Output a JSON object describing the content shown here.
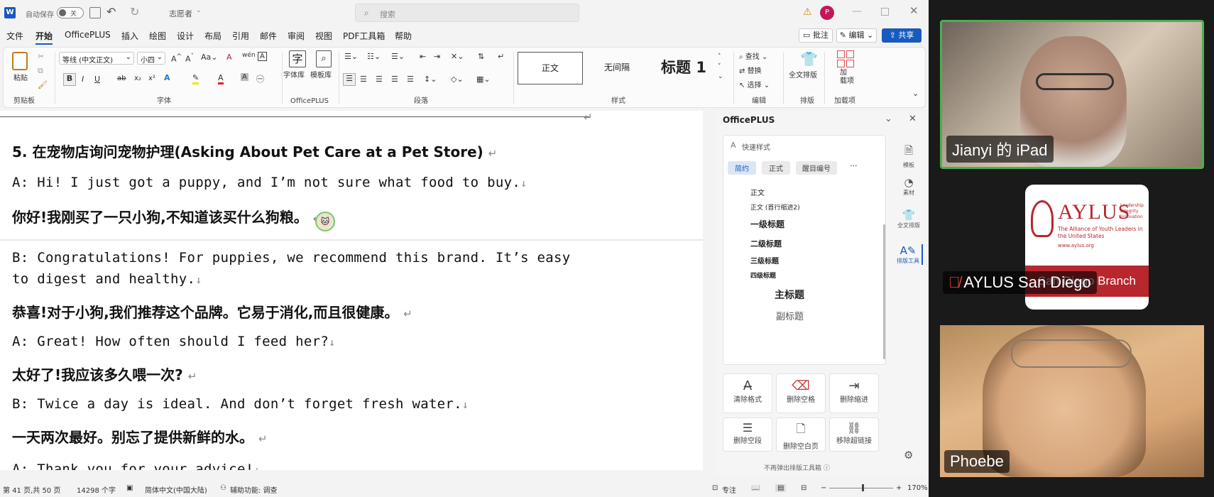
{
  "titlebar": {
    "autosave_label": "自动保存",
    "autosave_state": "关",
    "doc_title": "志愿者",
    "search_placeholder": "搜索",
    "avatar": "P"
  },
  "menu": [
    "文件",
    "开始",
    "OfficePLUS",
    "插入",
    "绘图",
    "设计",
    "布局",
    "引用",
    "邮件",
    "审阅",
    "视图",
    "PDF工具箱",
    "帮助"
  ],
  "menu_active": "开始",
  "actions": {
    "comment": "批注",
    "edit": "编辑",
    "share": "共享"
  },
  "ribbon": {
    "paste": "粘贴",
    "clipboard": "剪贴板",
    "font_name": "等线 (中文正文)",
    "font_size": "小四",
    "font_group": "字体",
    "zitiku": "字体库",
    "mobanku": "模板库",
    "officeplus_group": "OfficePLUS",
    "paragraph_group": "段落",
    "styles": [
      "正文",
      "无间隔",
      "标题 1"
    ],
    "styles_group": "样式",
    "find": "查找",
    "replace": "替换",
    "select": "选择",
    "edit_group": "编辑",
    "layout": "全文排版",
    "layout_group": "排版",
    "addin": "加\n载项",
    "addin_group": "加载项"
  },
  "doc": [
    {
      "t": "5. 在宠物店询问宠物护理(Asking About Pet Care at a Pet Store)",
      "k": "h"
    },
    {
      "t": "A: Hi! I just got a puppy, and I’m not sure what food to buy.",
      "k": "en",
      "m": "↓"
    },
    {
      "t": "你好!我刚买了一只小狗,不知道该买什么狗粮。",
      "k": "zh",
      "m": "↵"
    },
    {
      "t": "B: Congratulations! For puppies, we recommend this brand. It’s easy",
      "k": "en",
      "m": ""
    },
    {
      "t": "to digest and healthy.",
      "k": "en",
      "m": "↓"
    },
    {
      "t": "恭喜!对于小狗,我们推荐这个品牌。它易于消化,而且很健康。",
      "k": "zh",
      "m": "↵"
    },
    {
      "t": "A: Great! How often should I feed her?",
      "k": "en",
      "m": "↓"
    },
    {
      "t": "太好了!我应该多久喂一次?",
      "k": "zh",
      "m": "↵"
    },
    {
      "t": "B: Twice a day is ideal. And don’t forget fresh water.",
      "k": "en",
      "m": "↓"
    },
    {
      "t": "一天两次最好。别忘了提供新鲜的水。",
      "k": "zh",
      "m": "↵"
    },
    {
      "t": "A: Thank you for your advice!",
      "k": "en",
      "m": "↓"
    }
  ],
  "pane": {
    "title": "OfficePLUS",
    "quick": "快速样式",
    "chips": [
      "简约",
      "正式",
      "醒目编号"
    ],
    "styles": [
      "正文",
      "正文 (首行缩进2)",
      "一级标题",
      "二级标题",
      "三级标题",
      "四级标题",
      "主标题",
      "副标题"
    ],
    "tools": [
      "清除格式",
      "删除空格",
      "删除缩进",
      "删除空段",
      "删除空白页",
      "移除超链接"
    ],
    "side": [
      "模板",
      "素材",
      "全文排版",
      "排版工具"
    ],
    "footer": "不再弹出排版工具箱"
  },
  "status": {
    "page": "第 41 页,共 50 页",
    "words": "14298 个字",
    "lang": "简体中文(中国大陆)",
    "access": "辅助功能: 调查",
    "focus": "专注",
    "zoom": "170%"
  },
  "video": {
    "p1": "Jianyi 的 iPad",
    "p2": "AYLUS San Diego",
    "p3": "Phoebe",
    "logo_title": "AYLUS",
    "logo_sub": "The Alliance of Youth Leaders in the United States",
    "logo_tag": "Leadership Integrity Innovation",
    "logo_url": "www.aylus.org",
    "logo_branch": "San Diego Branch"
  },
  "colors": {
    "accent": "#185abd",
    "green": "#4caf50",
    "aylus_red": "#b7272d"
  }
}
